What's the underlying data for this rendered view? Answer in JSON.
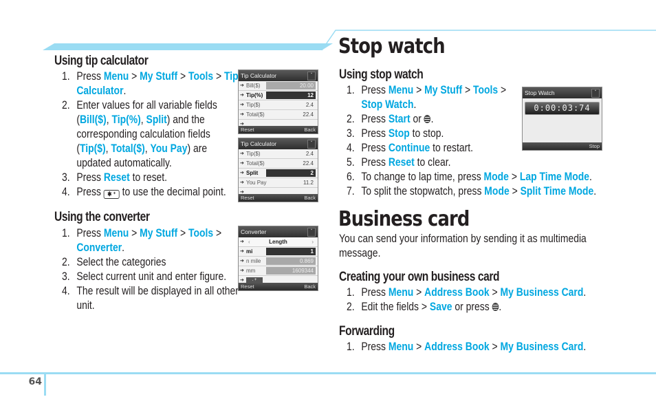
{
  "left": {
    "tip_calculator": {
      "heading": "Using tip calculator",
      "steps": [
        {
          "num": "1.",
          "parts": [
            {
              "t": "Press "
            },
            {
              "t": "Menu",
              "hl": true
            },
            {
              "t": " > "
            },
            {
              "t": "My Stuff",
              "hl": true
            },
            {
              "t": " > "
            },
            {
              "t": "Tools",
              "hl": true
            },
            {
              "t": " > "
            },
            {
              "t": "Tip",
              "hl": true
            }
          ],
          "cont": [
            [
              {
                "t": "Calculator",
                "hl": true
              },
              {
                "t": "."
              }
            ]
          ]
        },
        {
          "num": "2.",
          "parts": [
            {
              "t": "Enter values for all variable fields"
            }
          ],
          "cont": [
            [
              {
                "t": "("
              },
              {
                "t": "Bill($)",
                "hl": true
              },
              {
                "t": ", "
              },
              {
                "t": "Tip(%)",
                "hl": true
              },
              {
                "t": ", "
              },
              {
                "t": "Split",
                "hl": true
              },
              {
                "t": ") and the"
              }
            ],
            [
              {
                "t": "corresponding calculation fields"
              }
            ],
            [
              {
                "t": "("
              },
              {
                "t": "Tip($)",
                "hl": true
              },
              {
                "t": ", "
              },
              {
                "t": "Total($)",
                "hl": true
              },
              {
                "t": ", "
              },
              {
                "t": "You Pay",
                "hl": true
              },
              {
                "t": ") are"
              }
            ],
            [
              {
                "t": "updated automatically."
              }
            ]
          ]
        },
        {
          "num": "3.",
          "parts": [
            {
              "t": "Press "
            },
            {
              "t": "Reset",
              "hl": true
            },
            {
              "t": " to reset."
            }
          ]
        },
        {
          "num": "4.",
          "parts": [
            {
              "t": "Press "
            },
            {
              "icon": "star-key-icon",
              "label": "✱ ⁺"
            },
            {
              "t": " to use the decimal point."
            }
          ]
        }
      ]
    },
    "converter": {
      "heading": "Using the converter",
      "steps": [
        {
          "num": "1.",
          "parts": [
            {
              "t": "Press "
            },
            {
              "t": "Menu",
              "hl": true
            },
            {
              "t": " > "
            },
            {
              "t": "My Stuff",
              "hl": true
            },
            {
              "t": " > "
            },
            {
              "t": "Tools",
              "hl": true
            },
            {
              "t": " >"
            }
          ],
          "cont": [
            [
              {
                "t": "Converter",
                "hl": true
              },
              {
                "t": "."
              }
            ]
          ]
        },
        {
          "num": "2.",
          "parts": [
            {
              "t": "Select the categories"
            }
          ]
        },
        {
          "num": "3.",
          "parts": [
            {
              "t": "Select current unit and enter figure."
            }
          ]
        },
        {
          "num": "4.",
          "parts": [
            {
              "t": "The result will be displayed in all other"
            }
          ],
          "cont": [
            [
              {
                "t": "unit."
              }
            ]
          ]
        }
      ]
    }
  },
  "screens": {
    "tip1": {
      "title": "Tip Calculator",
      "rows": [
        {
          "label": "Bill($)",
          "value": "20.00",
          "style": "grey",
          "bold": false
        },
        {
          "label": "Tip(%)",
          "value": "12",
          "style": "dark",
          "bold": true
        },
        {
          "label": "Tip($)",
          "value": "2.4",
          "style": "",
          "bold": false
        },
        {
          "label": "Total($)",
          "value": "22.4",
          "style": "",
          "bold": false
        },
        {
          "label": "",
          "value": "",
          "style": "",
          "bold": false
        }
      ],
      "soft_left": "Reset",
      "soft_right": "Back"
    },
    "tip2": {
      "title": "Tip Calculator",
      "rows": [
        {
          "label": "Tip($)",
          "value": "2.4",
          "style": "",
          "bold": false
        },
        {
          "label": "Total($)",
          "value": "22.4",
          "style": "",
          "bold": false
        },
        {
          "label": "Split",
          "value": "2",
          "style": "dark",
          "bold": true
        },
        {
          "label": "You Pay",
          "value": "11.2",
          "style": "",
          "bold": false
        },
        {
          "label": "",
          "value": "",
          "style": "",
          "bold": false
        }
      ],
      "soft_left": "Reset",
      "soft_right": "Back"
    },
    "converter": {
      "title": "Converter",
      "category": "Length",
      "rows": [
        {
          "label": "mi",
          "value": "1",
          "style": "dark",
          "bold": true
        },
        {
          "label": "n mile",
          "value": "0.869",
          "style": "grey",
          "bold": false
        },
        {
          "label": "mm",
          "value": "1609344",
          "style": "grey",
          "bold": false
        }
      ],
      "key_row": ". +",
      "soft_left": "Reset",
      "soft_right": "Back"
    },
    "stopwatch": {
      "title": "Stop Watch",
      "time": "0:00:03:74",
      "soft_right": "Stop"
    }
  },
  "right": {
    "stopwatch_title": "Stop watch",
    "using_heading": "Using stop watch",
    "stopwatch_steps": [
      {
        "num": "1.",
        "parts": [
          {
            "t": "Press "
          },
          {
            "t": "Menu",
            "hl": true
          },
          {
            "t": " > "
          },
          {
            "t": "My Stuff",
            "hl": true
          },
          {
            "t": " > "
          },
          {
            "t": "Tools",
            "hl": true
          },
          {
            "t": " >"
          }
        ],
        "cont": [
          [
            {
              "t": "Stop Watch",
              "hl": true
            },
            {
              "t": "."
            }
          ]
        ]
      },
      {
        "num": "2.",
        "parts": [
          {
            "t": "Press "
          },
          {
            "t": "Start",
            "hl": true
          },
          {
            "t": " or "
          },
          {
            "icon": "att-icon"
          },
          {
            "t": "."
          }
        ]
      },
      {
        "num": "3.",
        "parts": [
          {
            "t": "Press "
          },
          {
            "t": "Stop",
            "hl": true
          },
          {
            "t": " to stop."
          }
        ]
      },
      {
        "num": "4.",
        "parts": [
          {
            "t": "Press "
          },
          {
            "t": "Continue",
            "hl": true
          },
          {
            "t": " to restart."
          }
        ]
      },
      {
        "num": "5.",
        "parts": [
          {
            "t": "Press "
          },
          {
            "t": "Reset",
            "hl": true
          },
          {
            "t": " to clear."
          }
        ]
      },
      {
        "num": "6.",
        "parts": [
          {
            "t": "To change to lap time, press "
          },
          {
            "t": "Mode",
            "hl": true
          },
          {
            "t": " > "
          },
          {
            "t": "Lap Time Mode",
            "hl": true
          },
          {
            "t": "."
          }
        ]
      },
      {
        "num": "7.",
        "parts": [
          {
            "t": "To split the stopwatch, press "
          },
          {
            "t": "Mode",
            "hl": true
          },
          {
            "t": " > "
          },
          {
            "t": "Split Time Mode",
            "hl": true
          },
          {
            "t": "."
          }
        ]
      }
    ],
    "business_title": "Business card",
    "business_intro_1": "You can send your information by sending it as multimedia",
    "business_intro_2": "message.",
    "creating_heading": "Creating your own business card",
    "creating_steps": [
      {
        "num": "1.",
        "parts": [
          {
            "t": "Press "
          },
          {
            "t": "Menu",
            "hl": true
          },
          {
            "t": " > "
          },
          {
            "t": "Address Book",
            "hl": true
          },
          {
            "t": " > "
          },
          {
            "t": "My Business Card",
            "hl": true
          },
          {
            "t": "."
          }
        ]
      },
      {
        "num": "2.",
        "parts": [
          {
            "t": "Edit the fields > "
          },
          {
            "t": "Save",
            "hl": true
          },
          {
            "t": " or press "
          },
          {
            "icon": "att-icon"
          },
          {
            "t": "."
          }
        ]
      }
    ],
    "forwarding_heading": "Forwarding",
    "forwarding_steps": [
      {
        "num": "1.",
        "parts": [
          {
            "t": "Press "
          },
          {
            "t": "Menu",
            "hl": true
          },
          {
            "t": " > "
          },
          {
            "t": "Address Book",
            "hl": true
          },
          {
            "t": " > "
          },
          {
            "t": "My Business Card",
            "hl": true
          },
          {
            "t": "."
          }
        ]
      }
    ]
  },
  "footer": {
    "page_number": "64"
  },
  "colors": {
    "accent": "#00a7e0",
    "rule": "#9adcf3",
    "text": "#231f20"
  }
}
